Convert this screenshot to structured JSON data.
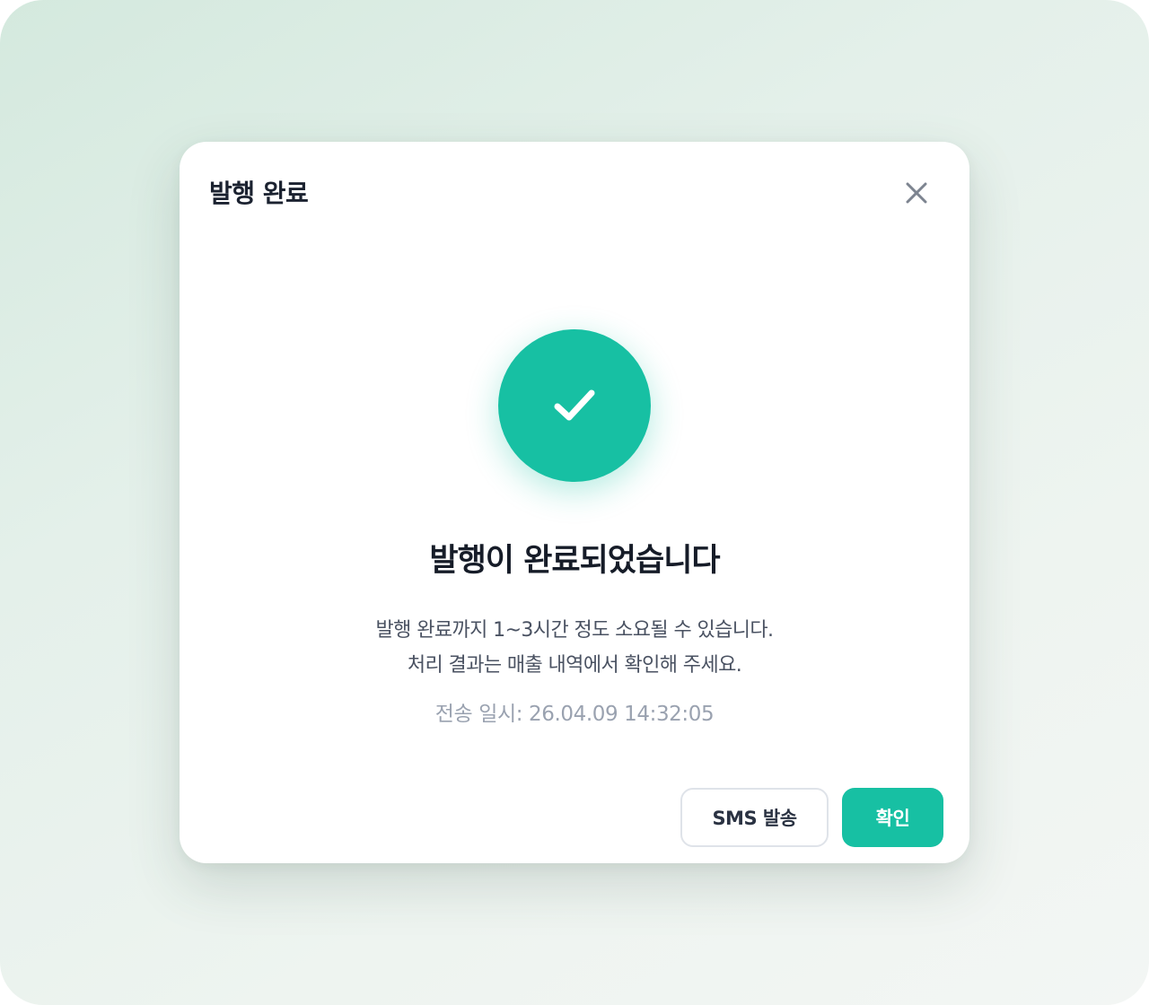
{
  "modal": {
    "title": "발행 완료",
    "close_icon": "close-icon"
  },
  "status": {
    "icon": "check-icon",
    "accent_color": "#17c0a3",
    "headline": "발행이 완료되었습니다",
    "description_line1": "발행 완료까지 1~3시간 정도 소요될 수 있습니다.",
    "description_line2": "처리 결과는 매출 내역에서 확인해 주세요.",
    "sent_at_label": "전송 일시:",
    "sent_at_value": "26.04.09 14:32:05"
  },
  "actions": {
    "sms_label": "SMS 발송",
    "confirm_label": "확인"
  }
}
